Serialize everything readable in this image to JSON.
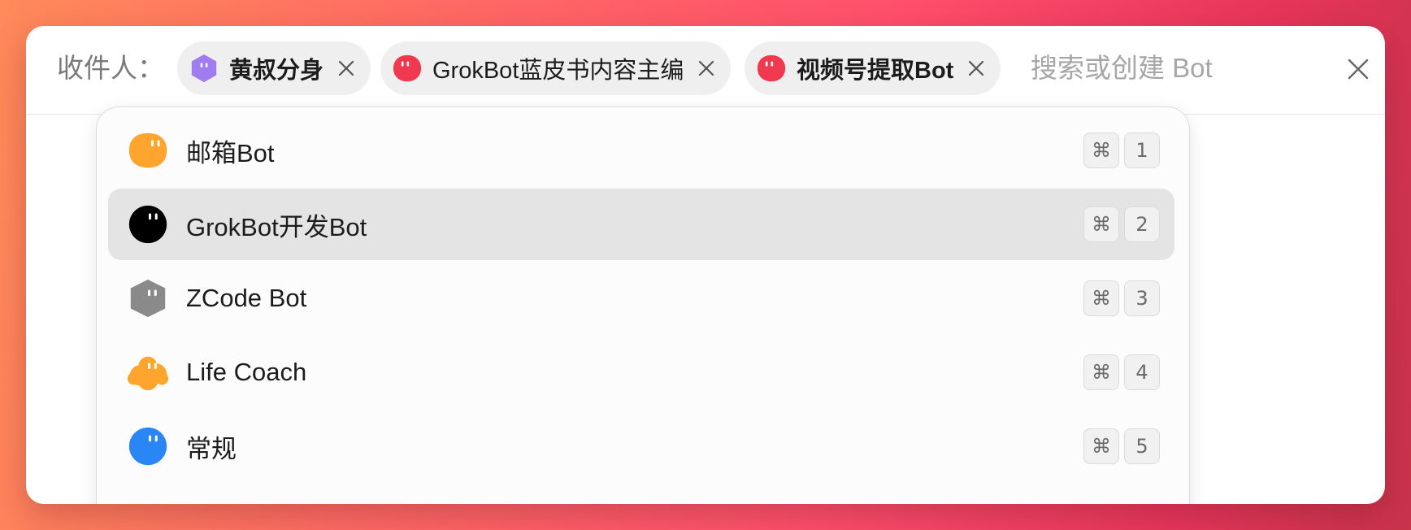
{
  "recipient_bar": {
    "label": "收件人：",
    "chips": [
      {
        "label": "黄叔分身",
        "avatar": "purple-hexagon-bot-icon",
        "color": "#a07cf0"
      },
      {
        "label": "GrokBot蓝皮书内容主编",
        "avatar": "red-blob-bot-icon",
        "color": "#f0384f"
      },
      {
        "label": "视频号提取Bot",
        "avatar": "red-blob-bot-icon",
        "color": "#f0384f"
      }
    ],
    "search": {
      "value": "",
      "placeholder": "搜索或创建 Bot"
    },
    "close_icon": "close-icon"
  },
  "dropdown": {
    "selected_index": 1,
    "items": [
      {
        "name": "邮箱Bot",
        "avatar": "orange-blob-bot-icon",
        "color": "#ffa52e",
        "shortcut": [
          "⌘",
          "1"
        ]
      },
      {
        "name": "GrokBot开发Bot",
        "avatar": "black-circle-bot-icon",
        "color": "#000000",
        "shortcut": [
          "⌘",
          "2"
        ]
      },
      {
        "name": "ZCode Bot",
        "avatar": "gray-hexagon-bot-icon",
        "color": "#8a8a8a",
        "shortcut": [
          "⌘",
          "3"
        ]
      },
      {
        "name": "Life Coach",
        "avatar": "orange-cloud-bot-icon",
        "color": "#ffa52e",
        "shortcut": [
          "⌘",
          "4"
        ]
      },
      {
        "name": "常规",
        "avatar": "blue-circle-bot-icon",
        "color": "#2a86f4",
        "shortcut": [
          "⌘",
          "5"
        ]
      }
    ]
  }
}
